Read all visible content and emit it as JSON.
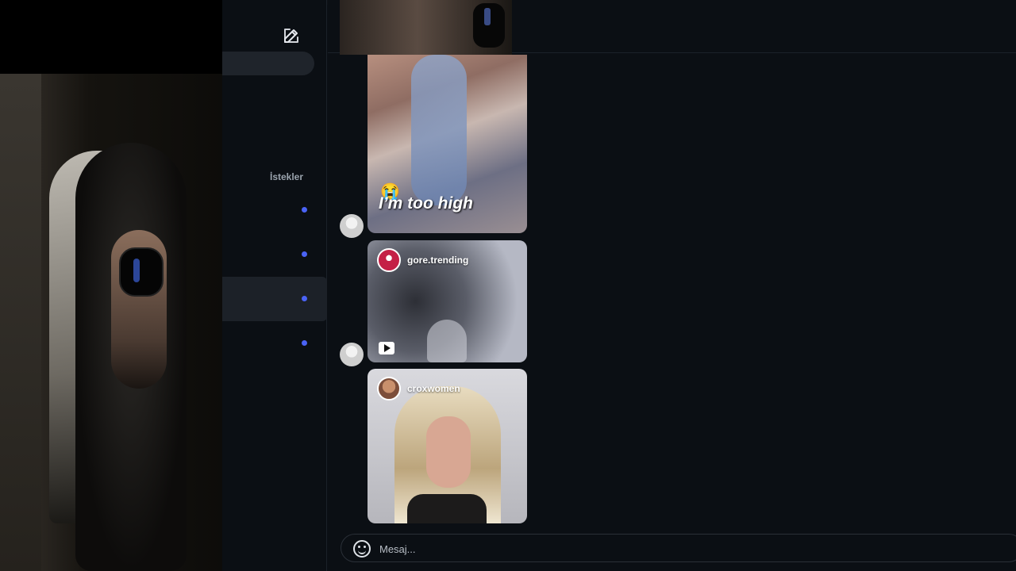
{
  "sidebar": {
    "compose_icon": "edit-icon",
    "requests_label": "İstekler",
    "unread_dot_color": "#4a63f5"
  },
  "thread": {
    "messages": [
      {
        "type": "video",
        "caption_emoji": "😭",
        "caption": "I’m too high"
      },
      {
        "type": "reel",
        "account": "gore.trending"
      },
      {
        "type": "reel",
        "account": "croxwomen"
      }
    ]
  },
  "composer": {
    "placeholder": "Mesaj...",
    "emoji_icon": "smiley-icon"
  },
  "colors": {
    "background": "#0b0f14",
    "active_row": "#1c2128",
    "accent": "#4a63f5"
  }
}
